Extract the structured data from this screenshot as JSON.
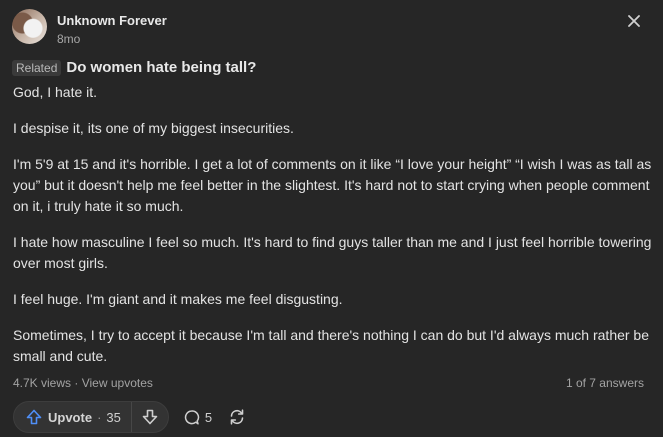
{
  "author": {
    "name": "Unknown Forever",
    "time": "8mo"
  },
  "question": {
    "badge": "Related",
    "title": "Do women hate being tall?"
  },
  "answer": {
    "paragraphs": [
      "God, I hate it.",
      "I despise it, its one of my biggest insecurities.",
      "I'm 5'9 at 15 and it's horrible. I get a lot of comments on it like “I love your height” “I wish I was as tall as you” but it doesn't help me feel better in the slightest. It's hard not to start crying when people comment on it, i truly hate it so much.",
      "I hate how masculine I feel so much. It's hard to find guys taller than me and I just feel horrible towering over most girls.",
      "I feel huge. I'm giant and it makes me feel disgusting.",
      "Sometimes, I try to accept it because I'm tall and there's nothing I can do but I'd always much rather be small and cute."
    ]
  },
  "meta": {
    "views": "4.7K views",
    "separator": "·",
    "upvotes_link": "View upvotes",
    "answers_position": "1 of 7 answers"
  },
  "actions": {
    "upvote_label": "Upvote",
    "dot": "·",
    "upvote_count": "35",
    "comment_count": "5"
  },
  "icons": {
    "close": "close-icon",
    "upvote": "upvote-arrow-icon",
    "downvote": "downvote-arrow-icon",
    "comment": "comment-bubble-icon",
    "share": "share-icon"
  },
  "colors": {
    "background": "#262626",
    "upvote_accent": "#4f8ff7",
    "text": "#e3e3e3",
    "muted": "#a3a3a3"
  }
}
